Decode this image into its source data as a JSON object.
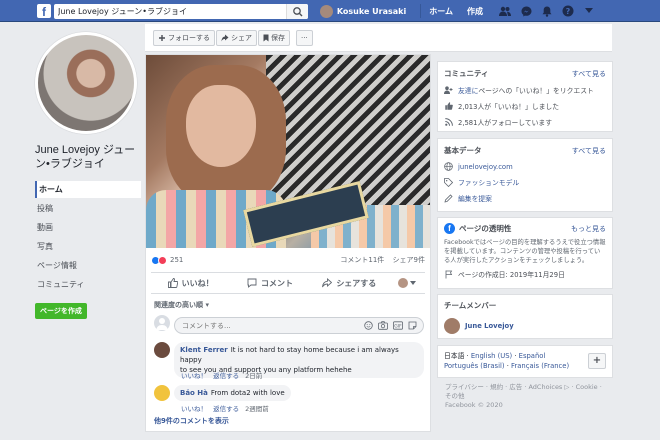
{
  "topbar": {
    "logo": "f",
    "search_value": "June Lovejoy ジューン•ラブジョイ",
    "user_name": "Kosuke Urasaki",
    "home": "ホーム",
    "create": "作成"
  },
  "left": {
    "page_name": "June Lovejoy ジューン•ラブジョイ",
    "menu": [
      "ホーム",
      "投稿",
      "動画",
      "写真",
      "ページ情報",
      "コミュニティ"
    ],
    "create_page": "ページを作成"
  },
  "actionbar": {
    "follow": "フォローする",
    "share": "シェア",
    "save": "保存",
    "more": "···"
  },
  "post": {
    "reaction_count": "251",
    "comment_count": "コメント11件",
    "share_count": "シェア9件",
    "like": "いいね！",
    "comment": "コメント",
    "share": "シェアする",
    "sort_label": "関連度の高い順",
    "composer_placeholder": "コメントする...",
    "comments": [
      {
        "author": "Klent Ferrer",
        "text_line1": "It is not hard to stay home because i am always happy",
        "text_line2": "to see you and support you any platform hehehe",
        "like": "いいね！",
        "reply": "返信する",
        "time": "2日前"
      },
      {
        "author": "Bảo Hà",
        "text_line1": "From dota2 with love",
        "like": "いいね！",
        "reply": "返信する",
        "time": "2週間前"
      }
    ],
    "more_comments": "他9件のコメントを表示"
  },
  "community": {
    "title": "コミュニティ",
    "see_all": "すべて見る",
    "invite_prefix": "友達に",
    "invite_rest": "ページへの「いいね！」をリクエスト",
    "likes": "2,013人が「いいね！」しました",
    "follows": "2,581人がフォローしています"
  },
  "about": {
    "title": "基本データ",
    "see_all": "すべて見る",
    "website": "junelovejoy.com",
    "category": "ファッションモデル",
    "suggest": "編集を提案"
  },
  "transparency": {
    "title": "ページの透明性",
    "see_more": "もっと見る",
    "desc_line1": "Facebookではページの目的を理解するうえで役立つ情報",
    "desc_line2": "を掲載しています。コンテンツの管理や投稿を行ってい",
    "desc_line3": "る人が実行したアクションをチェックしましょう。",
    "created": "ページの作成日: 2019年11月29日"
  },
  "team": {
    "title": "チームメンバー",
    "member": "June Lovejoy"
  },
  "languages": {
    "line1": [
      "日本語",
      "English (US)",
      "Español"
    ],
    "line2": [
      "Português (Brasil)",
      "Français (France)"
    ],
    "add": "+"
  },
  "footer": {
    "line1": "プライバシー · 規約 · 広告 · AdChoices ▷ · Cookie ·",
    "line2": "その他",
    "line3": "Facebook © 2020"
  },
  "colors": {
    "brand": "#4267b2",
    "green": "#42b72a",
    "link": "#385898"
  }
}
